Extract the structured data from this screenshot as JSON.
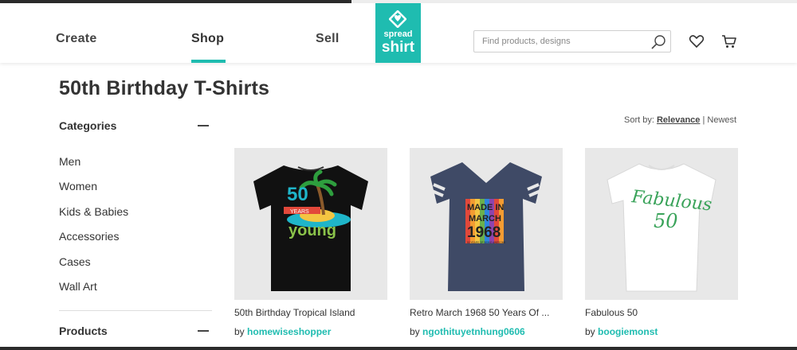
{
  "nav": {
    "items": [
      {
        "label": "Create"
      },
      {
        "label": "Shop",
        "active": true
      },
      {
        "label": "Sell"
      }
    ]
  },
  "logo": {
    "line1": "spread",
    "line2": "shirt",
    "color": "#1fbcb0"
  },
  "search": {
    "placeholder": "Find products, designs",
    "value": ""
  },
  "icons": {
    "search": "search-icon",
    "wishlist": "heart-icon",
    "cart": "cart-icon"
  },
  "page": {
    "title": "50th Birthday T-Shirts"
  },
  "sidebar": {
    "categories_title": "Categories",
    "categories": [
      {
        "label": "Men"
      },
      {
        "label": "Women"
      },
      {
        "label": "Kids & Babies"
      },
      {
        "label": "Accessories"
      },
      {
        "label": "Cases"
      },
      {
        "label": "Wall Art"
      }
    ],
    "products_title": "Products"
  },
  "sort": {
    "label": "Sort by:",
    "relevance": "Relevance",
    "separator": "|",
    "newest": "Newest"
  },
  "products": [
    {
      "name": "50th Birthday Tropical Island",
      "by_label": "by",
      "designer": "homewiseshopper",
      "design": {
        "top": "50",
        "ribbon": "YEARS",
        "bottom": "young",
        "shirt_color": "#111111"
      }
    },
    {
      "name": "Retro March 1968 50 Years Of ...",
      "by_label": "by",
      "designer": "ngothituyetnhung0606",
      "design": {
        "line1": "MADE IN",
        "line2": "MARCH",
        "line3": "1968",
        "small": "50 YEARS OF BEING AWESOME",
        "shirt_color": "#3f4a66"
      }
    },
    {
      "name": "Fabulous 50",
      "by_label": "by",
      "designer": "boogiemonst",
      "design": {
        "line1": "Fabulous",
        "line2": "50",
        "shirt_color": "#ffffff"
      }
    }
  ],
  "colors": {
    "accent": "#1fbcb0",
    "text": "#333333"
  }
}
